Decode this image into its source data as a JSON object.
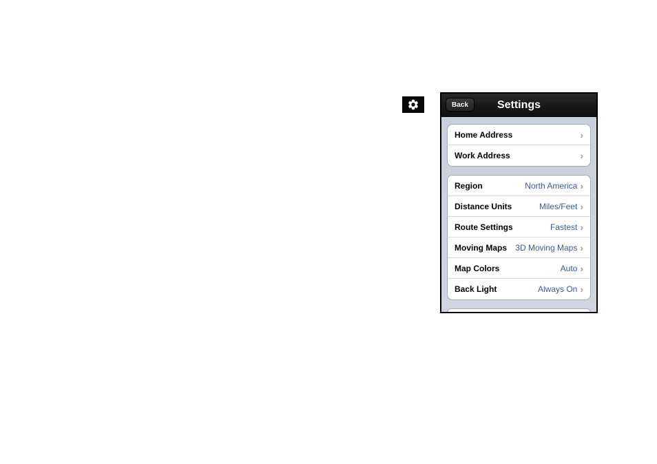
{
  "header": {
    "back_label": "Back",
    "title": "Settings"
  },
  "groups": [
    {
      "rows": [
        {
          "label": "Home Address",
          "value": ""
        },
        {
          "label": "Work Address",
          "value": ""
        }
      ]
    },
    {
      "rows": [
        {
          "label": "Region",
          "value": "North America"
        },
        {
          "label": "Distance Units",
          "value": "Miles/Feet"
        },
        {
          "label": "Route Settings",
          "value": "Fastest"
        },
        {
          "label": "Moving Maps",
          "value": "3D Moving Maps"
        },
        {
          "label": "Map Colors",
          "value": "Auto"
        },
        {
          "label": "Back Light",
          "value": "Always On"
        }
      ]
    }
  ],
  "icons": {
    "gear": "gear-icon"
  }
}
